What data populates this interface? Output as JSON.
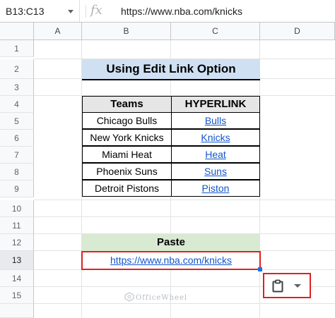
{
  "formula_bar": {
    "name_box": "B13:C13",
    "fx_label": "fx",
    "formula": "https://www.nba.com/knicks"
  },
  "columns": [
    "A",
    "B",
    "C",
    "D"
  ],
  "rows": [
    "1",
    "2",
    "3",
    "4",
    "5",
    "6",
    "7",
    "8",
    "9",
    "10",
    "11",
    "12",
    "13",
    "14",
    "15"
  ],
  "title": "Using Edit Link Option",
  "table": {
    "headers": [
      "Teams",
      "HYPERLINK"
    ],
    "rows": [
      {
        "team": "Chicago Bulls",
        "link": "Bulls"
      },
      {
        "team": "New York Knicks",
        "link": "Knicks"
      },
      {
        "team": "Miami Heat",
        "link": "Heat"
      },
      {
        "team": "Phoenix Suns",
        "link": "Suns"
      },
      {
        "team": "Detroit Pistons",
        "link": "Piston"
      }
    ]
  },
  "paste": {
    "header": "Paste",
    "value": "https://www.nba.com/knicks"
  },
  "paste_menu": {
    "icon": "clipboard-icon"
  },
  "watermark": "OfficeWheel",
  "colors": {
    "title_bg": "#d0e0f3",
    "paste_header_bg": "#d9ead3",
    "link": "#1155cc",
    "highlight": "#e02020"
  }
}
